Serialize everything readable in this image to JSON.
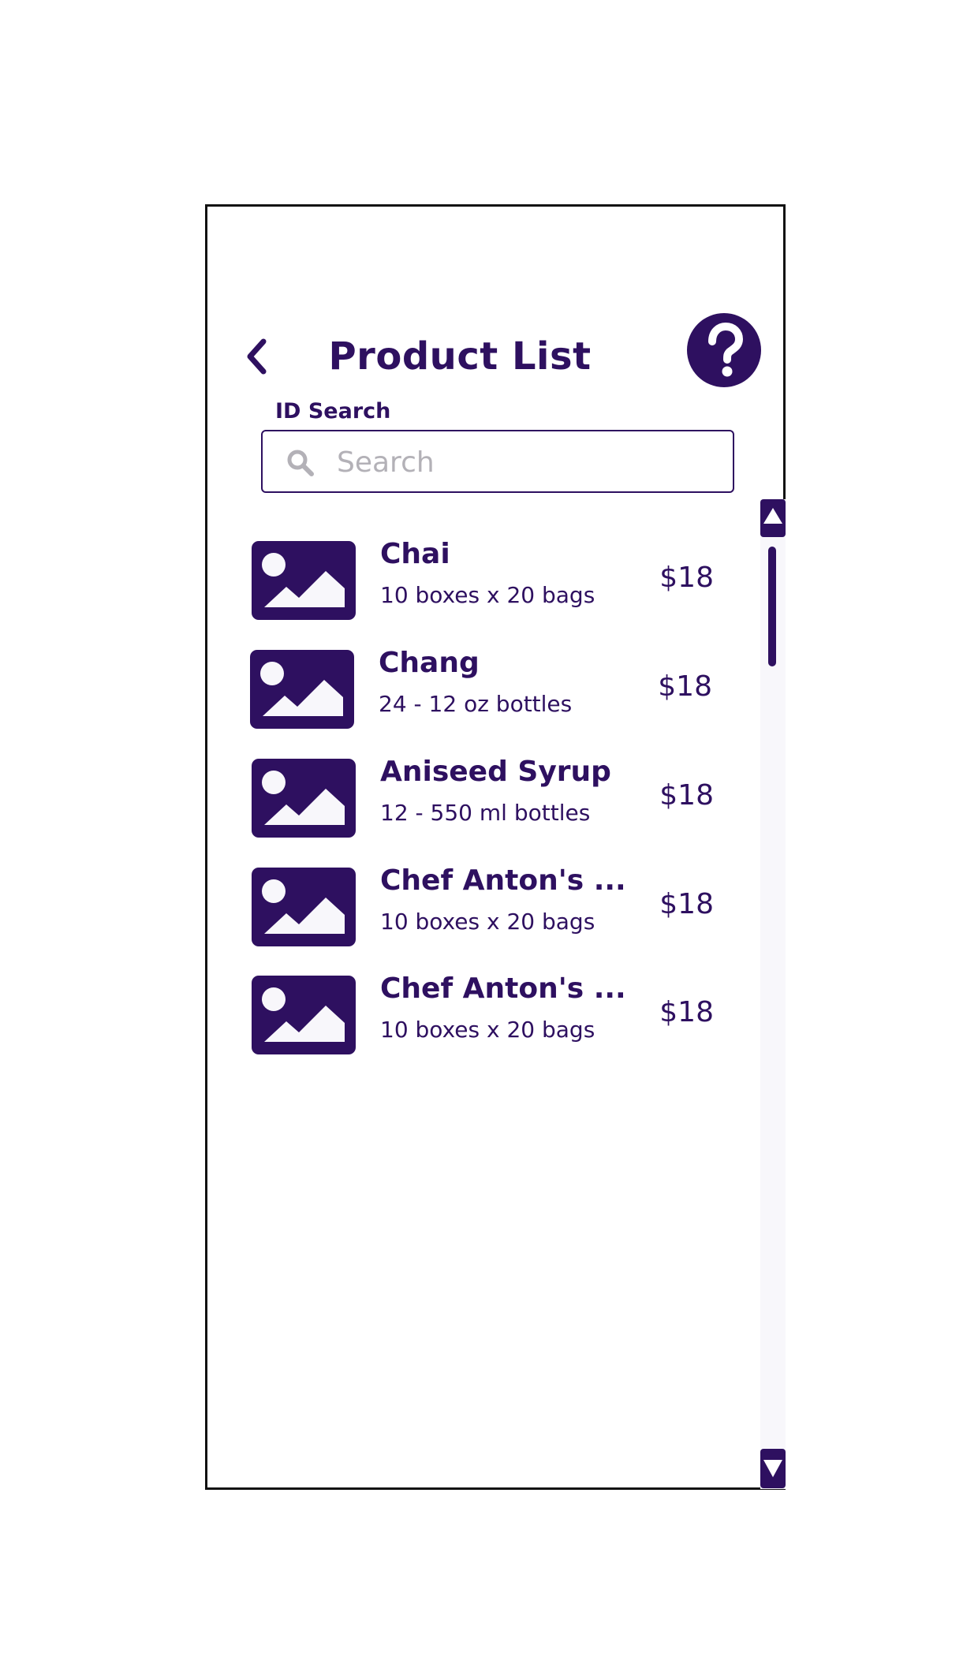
{
  "header": {
    "title": "Product List",
    "back_icon": "chevron-left-icon",
    "help_icon": "question-mark-icon"
  },
  "search": {
    "label": "ID Search",
    "placeholder": "Search",
    "value": "",
    "icon": "search-icon"
  },
  "products": [
    {
      "name": "Chai",
      "description": "10 boxes x 20 bags",
      "price": "$18"
    },
    {
      "name": "Chang",
      "description": "24 - 12 oz bottles",
      "price": "$18"
    },
    {
      "name": "Aniseed Syrup",
      "description": "12 - 550 ml bottles",
      "price": "$18"
    },
    {
      "name": "Chef Anton's ...",
      "description": "10 boxes x 20 bags",
      "price": "$18"
    },
    {
      "name": "Chef Anton's ...",
      "description": "10 boxes x 20 bags",
      "price": "$18"
    }
  ],
  "scrollbar": {
    "up_icon": "triangle-up-icon",
    "down_icon": "triangle-down-icon"
  },
  "colors": {
    "primary": "#2e1060",
    "placeholder": "#b3b1b7",
    "track": "#f8f7fb",
    "frame_border": "#111111"
  }
}
